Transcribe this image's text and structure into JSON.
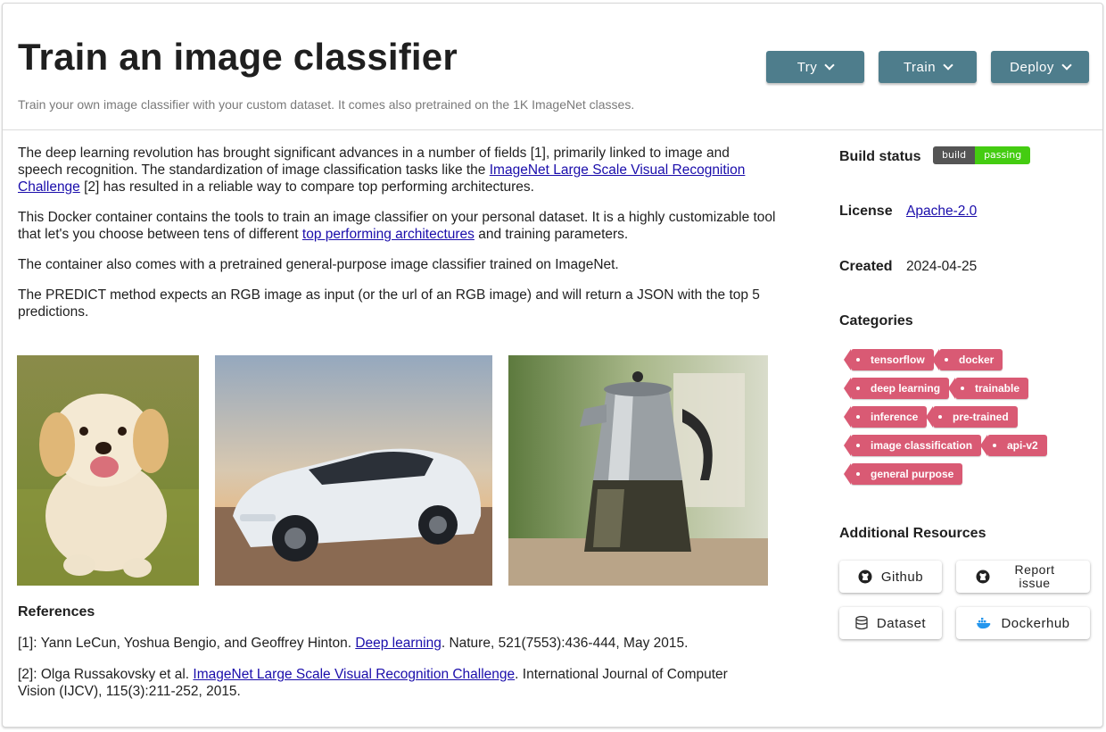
{
  "header": {
    "title": "Train an image classifier",
    "subtitle": "Train your own image classifier with your custom dataset. It comes also pretrained on the 1K ImageNet classes.",
    "buttons": [
      {
        "label": "Try"
      },
      {
        "label": "Train"
      },
      {
        "label": "Deploy"
      }
    ],
    "button_color": "#4e7d8c"
  },
  "description": {
    "p1_before": "The deep learning revolution has brought significant advances in a number of fields [1], primarily linked to image and speech recognition. The standardization of image classification tasks like the ",
    "p1_link": "ImageNet Large Scale Visual Recognition Challenge",
    "p1_after": " [2] has resulted in a reliable way to compare top performing architectures.",
    "p2_before": "This Docker container contains the tools to train an image classifier on your personal dataset. It is a highly customizable tool that let's you choose between tens of different ",
    "p2_link": "top performing architectures",
    "p2_after": " and training parameters.",
    "p3": "The container also comes with a pretrained general-purpose image classifier trained on ImageNet.",
    "p4": "The PREDICT method expects an RGB image as input (or the url of an RGB image) and will return a JSON with the top 5 predictions."
  },
  "images": [
    {
      "icon": "puppy-photo"
    },
    {
      "icon": "car-photo"
    },
    {
      "icon": "coffee-pot-photo"
    }
  ],
  "references": {
    "title": "References",
    "items": [
      {
        "prefix": "[1]: Yann LeCun, Yoshua Bengio, and Geoffrey Hinton. ",
        "link": "Deep learning",
        "suffix": ". Nature, 521(7553):436-444, May 2015."
      },
      {
        "prefix": "[2]: Olga Russakovsky et al. ",
        "link": "ImageNet Large Scale Visual Recognition Challenge",
        "suffix": ". International Journal of Computer Vision (IJCV), 115(3):211-252, 2015."
      }
    ]
  },
  "sidebar": {
    "build_status_label": "Build status",
    "badge_left": "build",
    "badge_right": "passing",
    "license_label": "License",
    "license_value": "Apache-2.0",
    "created_label": "Created",
    "created_value": "2024-04-25",
    "categories_label": "Categories",
    "tags": [
      "tensorflow",
      "docker",
      "deep learning",
      "trainable",
      "inference",
      "pre-trained",
      "image classification",
      "api-v2",
      "general purpose"
    ],
    "tag_color": "#d95a74",
    "resources_label": "Additional Resources",
    "resources": [
      {
        "label": "Github",
        "icon": "github-icon"
      },
      {
        "label": "Report issue",
        "icon": "github-icon"
      },
      {
        "label": "Dataset",
        "icon": "database-icon"
      },
      {
        "label": "Dockerhub",
        "icon": "docker-icon"
      }
    ]
  }
}
